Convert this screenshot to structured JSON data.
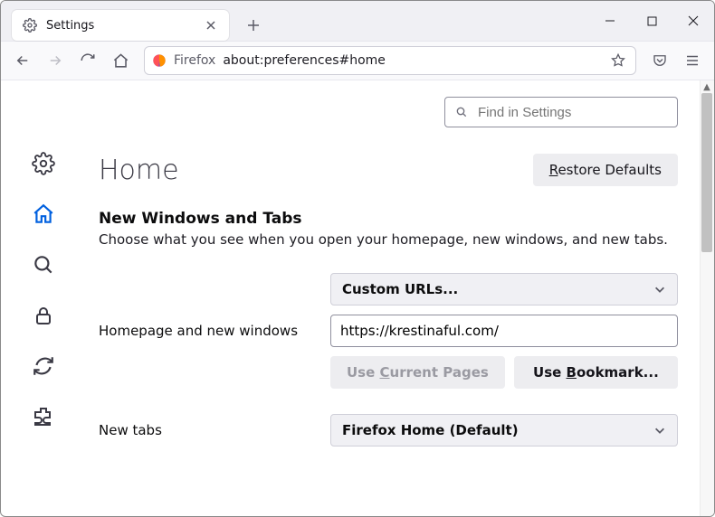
{
  "tab": {
    "title": "Settings"
  },
  "urlbar": {
    "protocol_label": "Firefox",
    "url": "about:preferences#home"
  },
  "search": {
    "placeholder": "Find in Settings"
  },
  "page": {
    "title": "Home",
    "restore_label": "Restore Defaults",
    "section_title": "New Windows and Tabs",
    "section_desc": "Choose what you see when you open your homepage, new windows, and new tabs."
  },
  "homepage": {
    "label": "Homepage and new windows",
    "dropdown": "Custom URLs...",
    "url_value": "https://krestinaful.com/",
    "use_current": "Use Current Pages",
    "use_bookmark": "Use Bookmark..."
  },
  "newtabs": {
    "label": "New tabs",
    "dropdown": "Firefox Home (Default)"
  }
}
